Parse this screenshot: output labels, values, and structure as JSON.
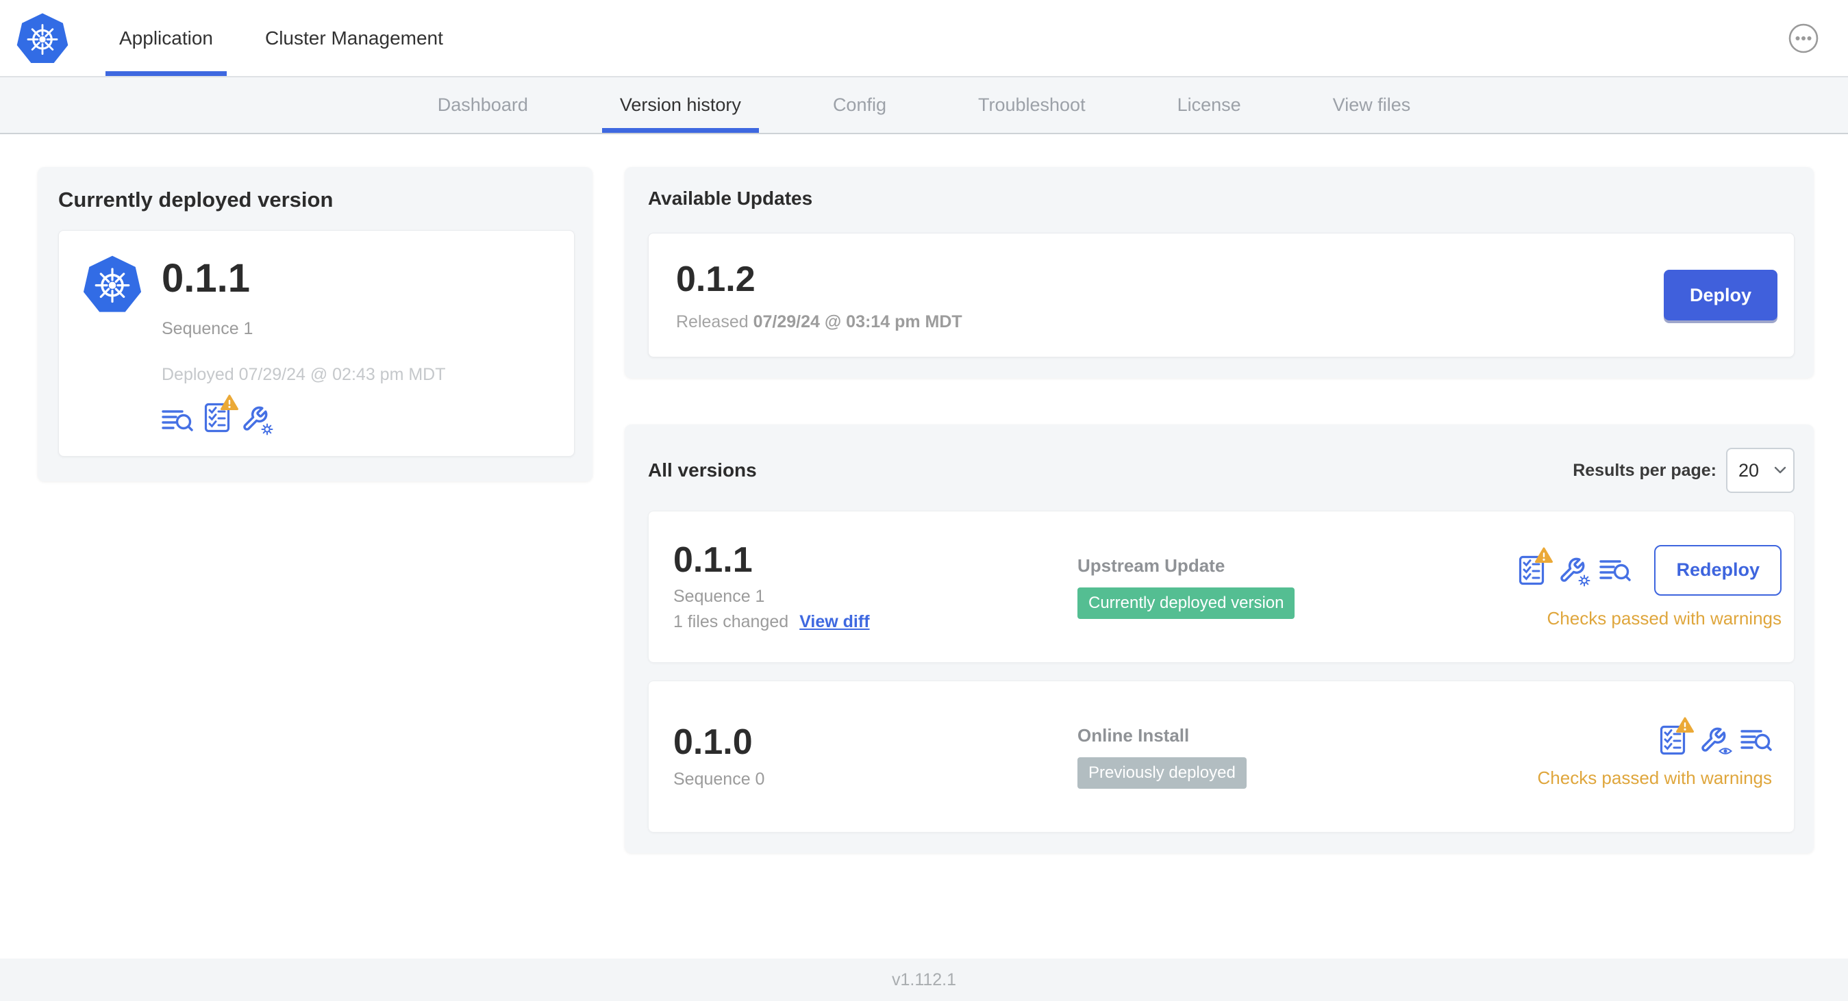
{
  "top_nav": {
    "tabs": [
      {
        "label": "Application"
      },
      {
        "label": "Cluster Management"
      }
    ]
  },
  "sub_nav": {
    "items": [
      {
        "label": "Dashboard"
      },
      {
        "label": "Version history"
      },
      {
        "label": "Config"
      },
      {
        "label": "Troubleshoot"
      },
      {
        "label": "License"
      },
      {
        "label": "View files"
      }
    ]
  },
  "current_version_card": {
    "title": "Currently deployed version",
    "version": "0.1.1",
    "sequence": "Sequence 1",
    "deployed": "Deployed 07/29/24 @ 02:43 pm MDT",
    "icons": [
      "view-logs-icon",
      "preflight-checks-warning-icon",
      "edit-config-icon"
    ]
  },
  "available_updates": {
    "title": "Available Updates",
    "version": "0.1.2",
    "released_label": "Released",
    "released_date": "07/29/24 @ 03:14 pm MDT",
    "deploy_label": "Deploy"
  },
  "all_versions": {
    "title": "All versions",
    "results_per_page_label": "Results per page:",
    "results_per_page_value": "20",
    "rows": [
      {
        "version": "0.1.1",
        "sequence": "Sequence 1",
        "files_changed": "1 files changed",
        "view_diff": "View diff",
        "source": "Upstream Update",
        "badge": "Currently deployed version",
        "badge_color": "#54BE92",
        "checks": "Checks passed with warnings",
        "action": "Redeploy",
        "icons": [
          "preflight-checks-warning-icon",
          "edit-config-icon",
          "view-logs-icon"
        ]
      },
      {
        "version": "0.1.0",
        "sequence": "Sequence 0",
        "source": "Online Install",
        "badge": "Previously deployed",
        "badge_color": "#B2BDC1",
        "checks": "Checks passed with warnings",
        "icons": [
          "preflight-checks-warning-icon",
          "view-config-icon",
          "view-logs-icon"
        ]
      }
    ]
  },
  "footer": {
    "version": "v1.112.1"
  },
  "colors": {
    "accent_blue": "#3E68E0",
    "button_blue": "#4060DC",
    "icon_blue": "#4570E4",
    "kubernetes_blue": "#326CE5",
    "badge_green": "#54BE92",
    "badge_gray": "#B2BDC1",
    "warning_amber": "#EBA937",
    "checks_amber": "#DFA63C",
    "subnav_bg": "#F4F6F8"
  }
}
